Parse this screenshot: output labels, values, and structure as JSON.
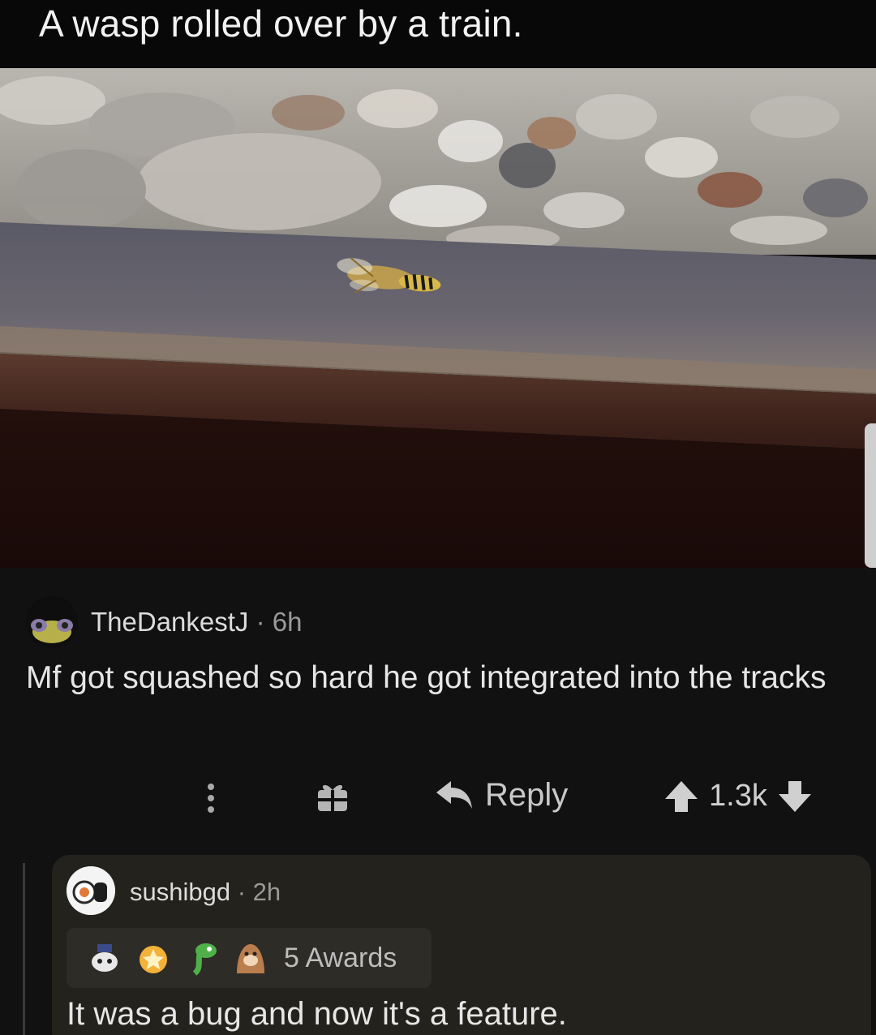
{
  "post": {
    "title": "A wasp rolled over by a train."
  },
  "comment": {
    "username": "TheDankestJ",
    "separator": "·",
    "age": "6h",
    "body": "Mf got squashed so hard he got integrated into the tracks",
    "reply_label": "Reply",
    "score": "1.3k"
  },
  "reply": {
    "username": "sushibgd",
    "separator": "·",
    "age": "2h",
    "awards_label": "5 Awards",
    "body": "It was a bug and now it's a feature."
  },
  "icons": [
    "more-vertical-icon",
    "gift-icon",
    "reply-arrow-icon",
    "upvote-icon",
    "downvote-icon"
  ],
  "colors": {
    "background": "#0e0e0f",
    "reply_card": "#24221c",
    "text": "#e6e6e6",
    "muted": "#9a9a9a"
  }
}
